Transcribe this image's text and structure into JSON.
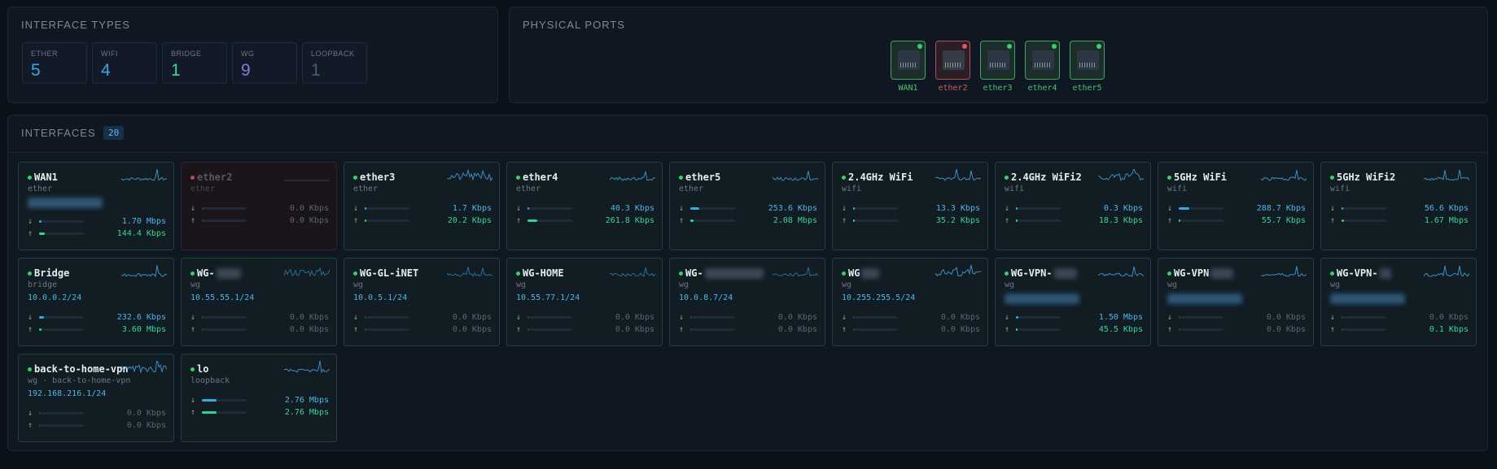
{
  "types_panel": {
    "title": "INTERFACE TYPES",
    "cards": [
      {
        "label": "ETHER",
        "count": "5",
        "color": "#3aa8e4"
      },
      {
        "label": "WIFI",
        "count": "4",
        "color": "#3aa8e4"
      },
      {
        "label": "BRIDGE",
        "count": "1",
        "color": "#3fd49a"
      },
      {
        "label": "WG",
        "count": "9",
        "color": "#8a7bd6"
      },
      {
        "label": "LOOPBACK",
        "count": "1",
        "color": "#4b5d78"
      }
    ]
  },
  "ports_panel": {
    "title": "PHYSICAL PORTS",
    "ports": [
      {
        "name": "WAN1",
        "status": "up"
      },
      {
        "name": "ether2",
        "status": "down"
      },
      {
        "name": "ether3",
        "status": "up"
      },
      {
        "name": "ether4",
        "status": "up"
      },
      {
        "name": "ether5",
        "status": "up"
      }
    ]
  },
  "interfaces_panel": {
    "title": "INTERFACES",
    "count": "20",
    "interfaces": [
      {
        "name": "WAN1",
        "type": "ether",
        "addr": "",
        "rx": "1.70 Mbps",
        "tx": "144.4 Kbps",
        "rx_level": 0.06,
        "tx_level": 0.12,
        "status": "up"
      },
      {
        "name": "ether2",
        "type": "ether",
        "addr": "",
        "rx": "0.0 Kbps",
        "tx": "0.0 Kbps",
        "rx_level": 0,
        "tx_level": 0,
        "status": "disabled"
      },
      {
        "name": "ether3",
        "type": "ether",
        "addr": "",
        "rx": "1.7 Kbps",
        "tx": "20.2 Kbps",
        "rx_level": 0.02,
        "tx_level": 0.03,
        "status": "up"
      },
      {
        "name": "ether4",
        "type": "ether",
        "addr": "",
        "rx": "40.3 Kbps",
        "tx": "261.8 Kbps",
        "rx_level": 0.03,
        "tx_level": 0.22,
        "status": "up"
      },
      {
        "name": "ether5",
        "type": "ether",
        "addr": "",
        "rx": "253.6 Kbps",
        "tx": "2.08 Mbps",
        "rx_level": 0.2,
        "tx_level": 0.08,
        "status": "up"
      },
      {
        "name": "2.4GHz WiFi",
        "type": "wifi",
        "addr": "",
        "rx": "13.3 Kbps",
        "tx": "35.2 Kbps",
        "rx_level": 0.02,
        "tx_level": 0.03,
        "status": "up"
      },
      {
        "name": "2.4GHz WiFi2",
        "type": "wifi",
        "addr": "",
        "rx": "0.3 Kbps",
        "tx": "18.3 Kbps",
        "rx_level": 0.01,
        "tx_level": 0.02,
        "status": "up"
      },
      {
        "name": "5GHz WiFi",
        "type": "wifi",
        "addr": "",
        "rx": "288.7 Kbps",
        "tx": "55.7 Kbps",
        "rx_level": 0.24,
        "tx_level": 0.03,
        "status": "up"
      },
      {
        "name": "5GHz WiFi2",
        "type": "wifi",
        "addr": "",
        "rx": "56.6 Kbps",
        "tx": "1.67 Mbps",
        "rx_level": 0.03,
        "tx_level": 0.06,
        "status": "up"
      },
      {
        "name": "Bridge",
        "type": "bridge",
        "addr": "10.0.0.2/24",
        "rx": "232.6 Kbps",
        "tx": "3.60 Mbps",
        "rx_level": 0.1,
        "tx_level": 0.06,
        "status": "up"
      },
      {
        "name": "WG-",
        "type": "wg",
        "addr": "10.55.55.1/24",
        "rx": "0.0 Kbps",
        "tx": "0.0 Kbps",
        "rx_level": 0,
        "tx_level": 0,
        "status": "up"
      },
      {
        "name": "WG-GL-iNET",
        "type": "wg",
        "addr": "10.0.5.1/24",
        "rx": "0.0 Kbps",
        "tx": "0.0 Kbps",
        "rx_level": 0,
        "tx_level": 0,
        "status": "up"
      },
      {
        "name": "WG-HOME",
        "type": "wg",
        "addr": "10.55.77.1/24",
        "rx": "0.0 Kbps",
        "tx": "0.0 Kbps",
        "rx_level": 0,
        "tx_level": 0,
        "status": "up"
      },
      {
        "name": "WG-",
        "type": "wg",
        "addr": "10.0.8.7/24",
        "rx": "0.0 Kbps",
        "tx": "0.0 Kbps",
        "rx_level": 0,
        "tx_level": 0,
        "status": "up"
      },
      {
        "name": "WG",
        "type": "wg",
        "addr": "10.255.255.5/24",
        "rx": "0.0 Kbps",
        "tx": "0.0 Kbps",
        "rx_level": 0,
        "tx_level": 0,
        "status": "up"
      },
      {
        "name": "WG-VPN-",
        "type": "wg",
        "addr": "",
        "rx": "1.50 Mbps",
        "tx": "45.5 Kbps",
        "rx_level": 0.06,
        "tx_level": 0.02,
        "status": "up"
      },
      {
        "name": "WG-VPN",
        "type": "wg",
        "addr": "",
        "rx": "0.0 Kbps",
        "tx": "0.0 Kbps",
        "rx_level": 0,
        "tx_level": 0,
        "status": "up"
      },
      {
        "name": "WG-VPN-",
        "type": "wg",
        "addr": "",
        "rx": "0.0 Kbps",
        "tx": "0.1 Kbps",
        "rx_level": 0,
        "tx_level": 0,
        "status": "up"
      },
      {
        "name": "back-to-home-vpn",
        "type": "wg · back-to-home-vpn",
        "addr": "192.168.216.1/24",
        "rx": "0.0 Kbps",
        "tx": "0.0 Kbps",
        "rx_level": 0,
        "tx_level": 0,
        "status": "up"
      },
      {
        "name": "lo",
        "type": "loopback",
        "addr": "",
        "rx": "2.76 Mbps",
        "tx": "2.76 Mbps",
        "rx_level": 0.32,
        "tx_level": 0.32,
        "status": "up"
      }
    ]
  },
  "icons": {
    "rx": "arrow-down-icon",
    "tx": "arrow-up-icon"
  },
  "arrows": {
    "rx": "↓",
    "tx": "↑"
  }
}
